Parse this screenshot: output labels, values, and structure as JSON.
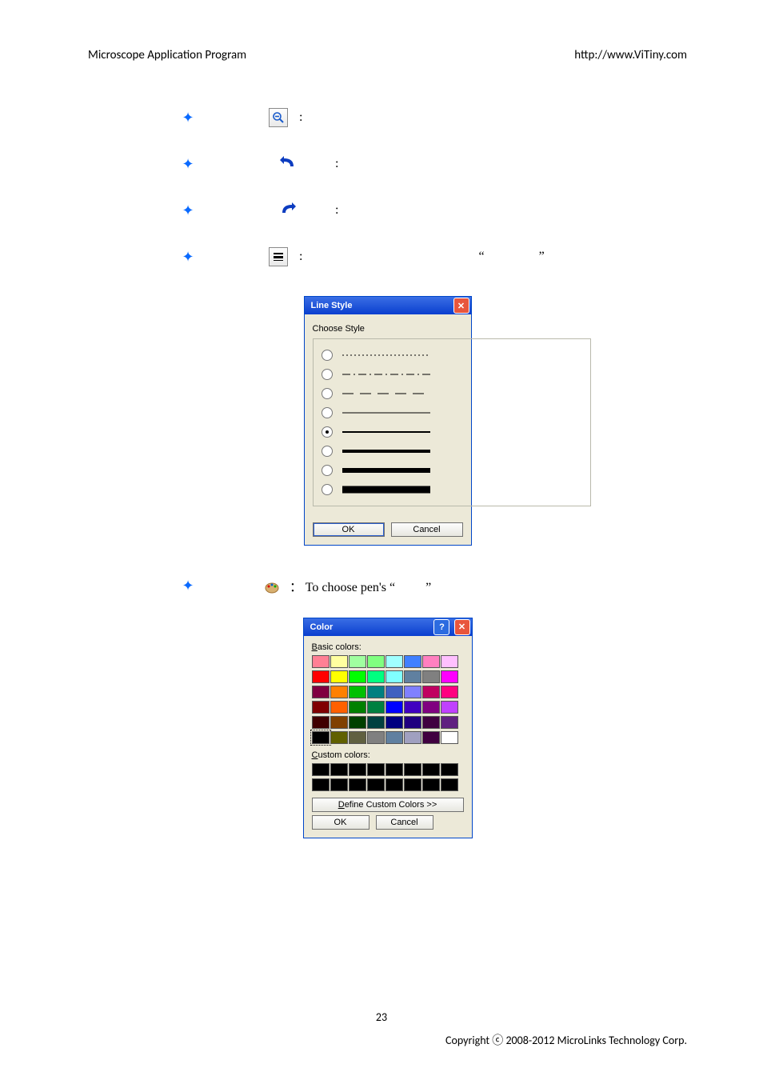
{
  "header": {
    "title": "Microscope Application Program",
    "url": "http://www.ViTiny.com"
  },
  "bullets": {
    "zoom": ":",
    "undo": ":",
    "redo": ":",
    "linestyle_before": ":",
    "linestyle_q1": "“",
    "linestyle_q2": "”"
  },
  "line_style_dialog": {
    "title": "Line Style",
    "group_label": "Choose Style",
    "ok": "OK",
    "cancel": "Cancel",
    "selected_index": 4
  },
  "color_bullet": {
    "text_a": "：",
    "text_b": "To choose pen's ",
    "q1": "“",
    "q2": "”"
  },
  "color_dialog": {
    "title": "Color",
    "basic_label_pre": "B",
    "basic_label": "asic colors:",
    "custom_label_pre": "C",
    "custom_label": "ustom colors:",
    "define_pre": "D",
    "define": "efine Custom Colors >>",
    "ok": "OK",
    "cancel": "Cancel",
    "basic_colors": [
      "#ff8094",
      "#ffffa0",
      "#a0ffa0",
      "#80ff80",
      "#a0ffff",
      "#4080ff",
      "#ff80c0",
      "#ffc0ff",
      "#ff0000",
      "#ffff00",
      "#00ff00",
      "#00ff80",
      "#80ffff",
      "#6080a0",
      "#808080",
      "#ff00ff",
      "#800040",
      "#ff8000",
      "#00c000",
      "#008080",
      "#4060c0",
      "#8080ff",
      "#c00060",
      "#ff0080",
      "#800000",
      "#ff6000",
      "#008000",
      "#008040",
      "#0000ff",
      "#4000c0",
      "#800080",
      "#c040ff",
      "#400000",
      "#804000",
      "#004000",
      "#004040",
      "#000080",
      "#200080",
      "#400040",
      "#602080",
      "#000000",
      "#606000",
      "#606040",
      "#808080",
      "#6080a0",
      "#a0a0c0",
      "#400040",
      "#ffffff"
    ],
    "custom_colors": [
      "#000000",
      "#000000",
      "#000000",
      "#000000",
      "#000000",
      "#000000",
      "#000000",
      "#000000",
      "#000000",
      "#000000",
      "#000000",
      "#000000",
      "#000000",
      "#000000",
      "#000000",
      "#000000"
    ]
  },
  "footer": {
    "page": "23",
    "copyright": "Copyright ⓒ 2008-2012 MicroLinks Technology Corp."
  }
}
